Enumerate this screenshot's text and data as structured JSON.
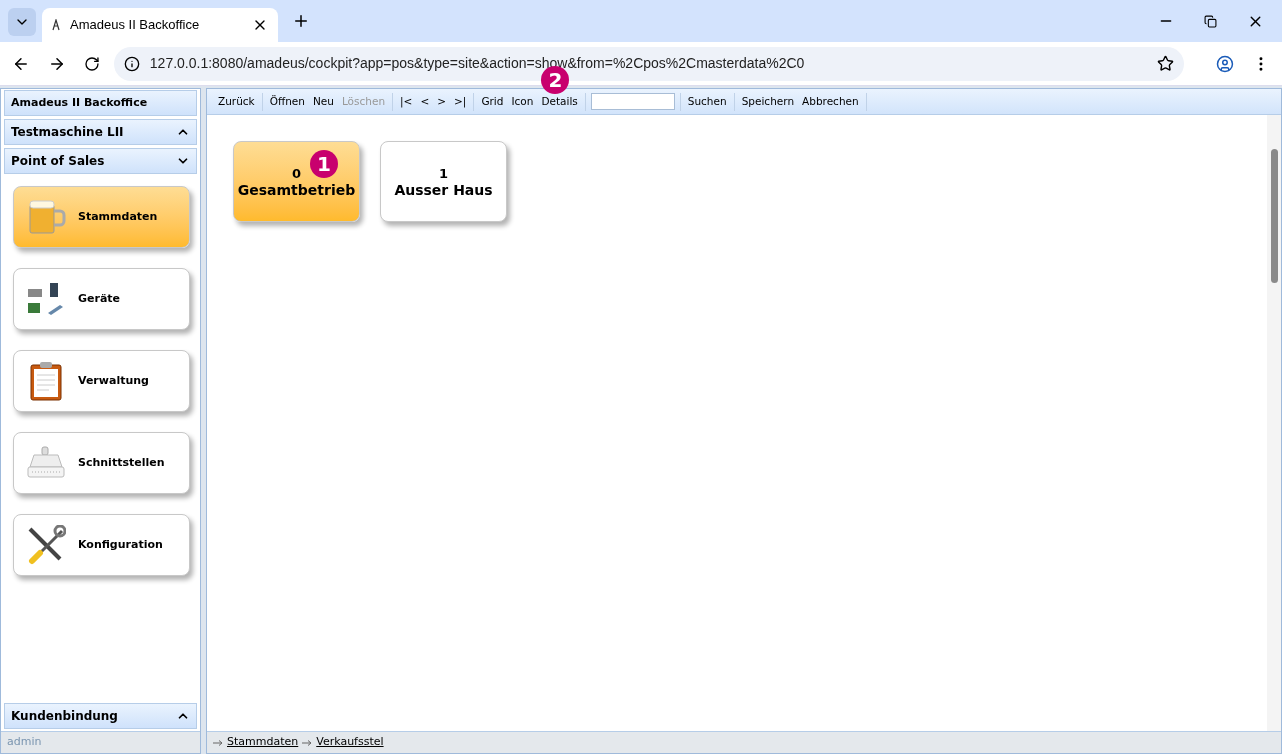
{
  "browser": {
    "tab_title": "Amadeus II Backoffice",
    "url": "127.0.0.1:8080/amadeus/cockpit?app=pos&type=site&action=show&from=%2Cpos%2Cmasterdata%2C0"
  },
  "sidebar": {
    "title": "Amadeus II Backoffice",
    "sections": [
      {
        "label": "Testmaschine LII",
        "expanded": false
      },
      {
        "label": "Point of Sales",
        "expanded": true
      }
    ],
    "items": [
      {
        "label": "Stammdaten",
        "selected": true
      },
      {
        "label": "Geräte",
        "selected": false
      },
      {
        "label": "Verwaltung",
        "selected": false
      },
      {
        "label": "Schnittstellen",
        "selected": false
      },
      {
        "label": "Konfiguration",
        "selected": false
      }
    ],
    "bottom_section": {
      "label": "Kundenbindung",
      "expanded": false
    },
    "user": "admin"
  },
  "toolbar": [
    {
      "kind": "buttons",
      "items": [
        {
          "label": "Zurück",
          "disabled": false
        }
      ]
    },
    {
      "kind": "buttons",
      "items": [
        {
          "label": "Öffnen",
          "disabled": false
        },
        {
          "label": "Neu",
          "disabled": false
        },
        {
          "label": "Löschen",
          "disabled": true
        }
      ]
    },
    {
      "kind": "buttons",
      "items": [
        {
          "label": "|<",
          "disabled": false
        },
        {
          "label": "<",
          "disabled": false
        },
        {
          "label": ">",
          "disabled": false
        },
        {
          "label": ">|",
          "disabled": false
        }
      ]
    },
    {
      "kind": "buttons",
      "items": [
        {
          "label": "Grid",
          "disabled": false
        },
        {
          "label": "Icon",
          "disabled": false
        },
        {
          "label": "Details",
          "disabled": false,
          "marker": "2"
        }
      ]
    },
    {
      "kind": "field"
    },
    {
      "kind": "buttons",
      "items": [
        {
          "label": "Suchen",
          "disabled": false
        }
      ]
    },
    {
      "kind": "buttons",
      "items": [
        {
          "label": "Speichern",
          "disabled": false
        },
        {
          "label": "Abbrechen",
          "disabled": false
        }
      ]
    }
  ],
  "sites": [
    {
      "number": "0",
      "name": "Gesamtbetrieb",
      "selected": true,
      "marker": "1"
    },
    {
      "number": "1",
      "name": "Ausser Haus",
      "selected": false
    }
  ],
  "breadcrumb": [
    "Stammdaten",
    "Verkaufsstel"
  ]
}
